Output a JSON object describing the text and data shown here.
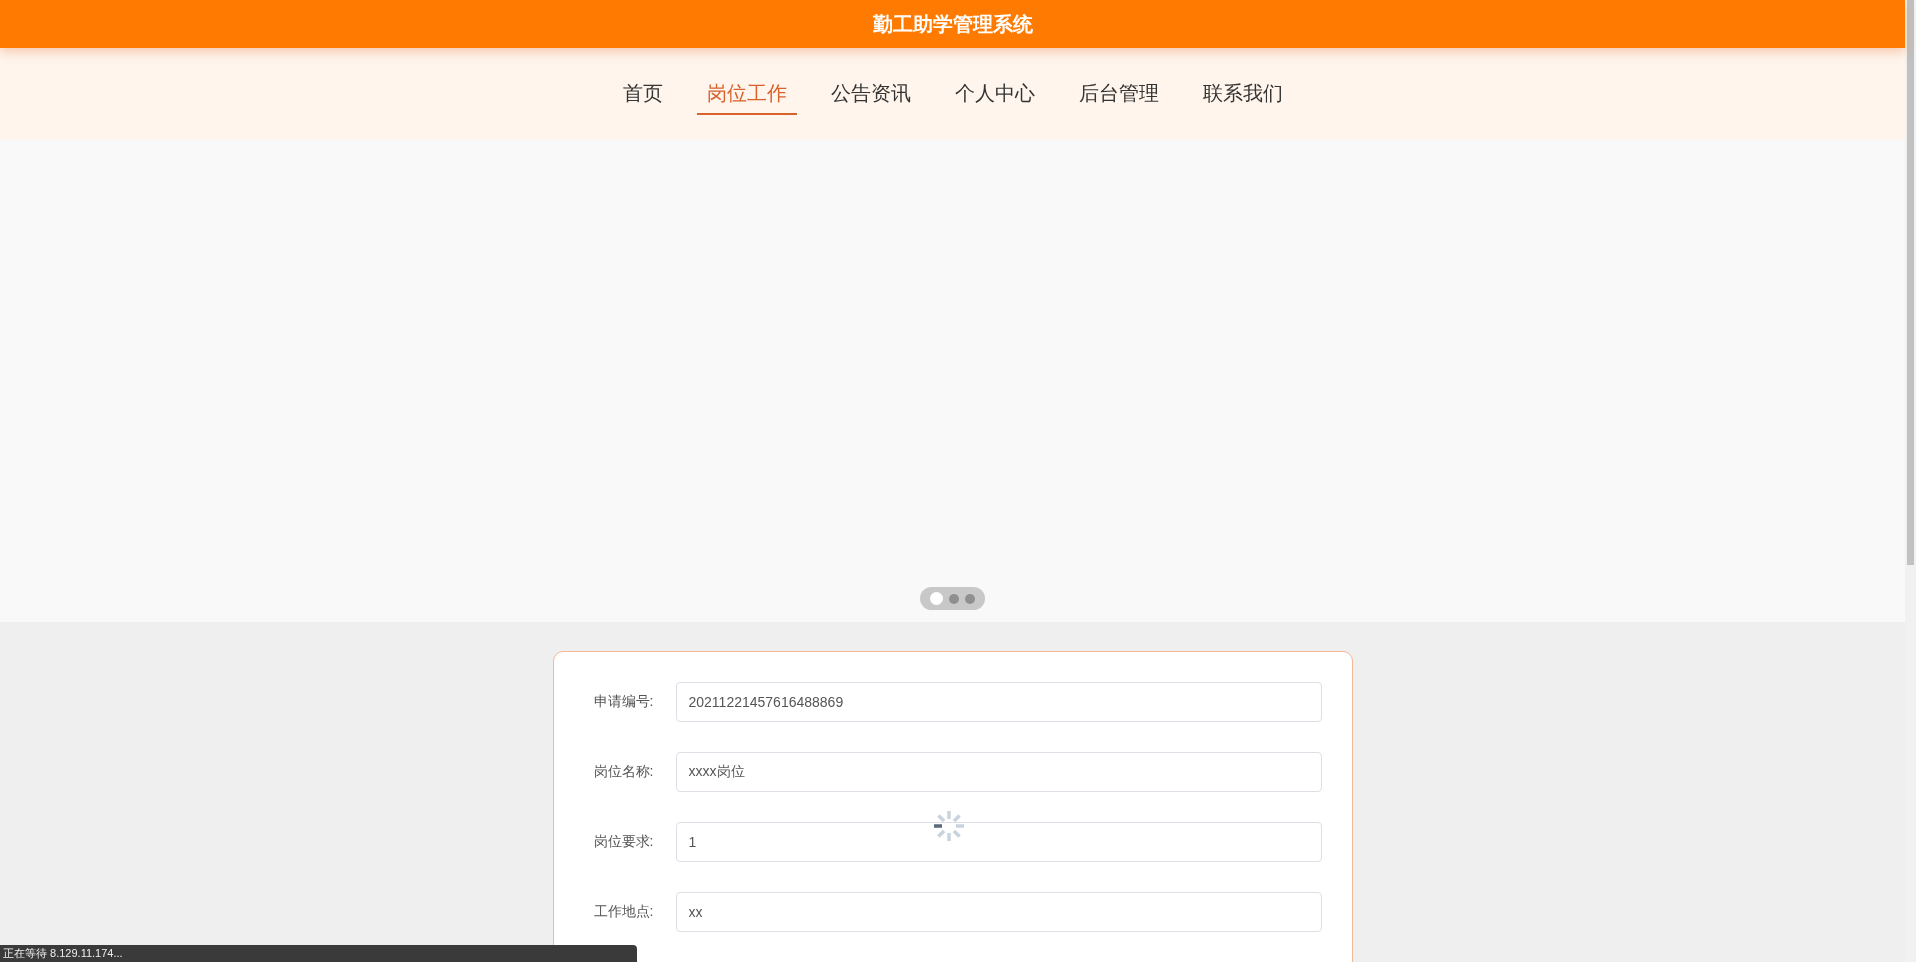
{
  "header": {
    "title": "勤工助学管理系统"
  },
  "nav": [
    {
      "label": "首页",
      "selected": false
    },
    {
      "label": "岗位工作",
      "selected": true
    },
    {
      "label": "公告资讯",
      "selected": false
    },
    {
      "label": "个人中心",
      "selected": false
    },
    {
      "label": "后台管理",
      "selected": false
    },
    {
      "label": "联系我们",
      "selected": false
    }
  ],
  "carousel": {
    "dots": [
      {
        "selected": true
      },
      {
        "selected": false
      },
      {
        "selected": false
      }
    ]
  },
  "form": {
    "fields": [
      {
        "label": "申请编号:",
        "value": "20211221457616488869"
      },
      {
        "label": "岗位名称:",
        "value": "xxxx岗位"
      },
      {
        "label": "岗位要求:",
        "value": "1"
      },
      {
        "label": "工作地点:",
        "value": "xx"
      }
    ]
  },
  "status_bar": {
    "text": "正在等待 8.129.11.174..."
  }
}
